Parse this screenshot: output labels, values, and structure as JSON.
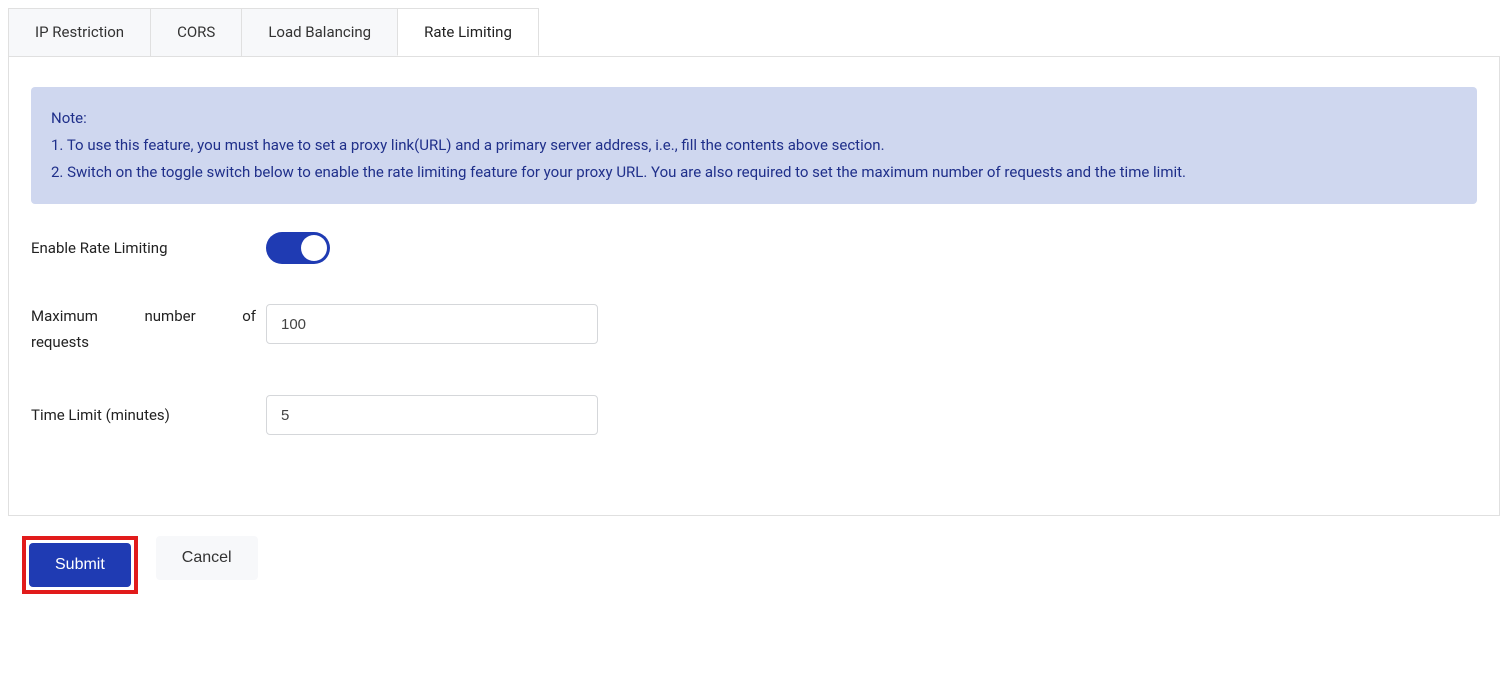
{
  "tabs": [
    {
      "label": "IP Restriction"
    },
    {
      "label": "CORS"
    },
    {
      "label": "Load Balancing"
    },
    {
      "label": "Rate Limiting"
    }
  ],
  "note": {
    "heading": "Note:",
    "line1": "1. To use this feature, you must have to set a proxy link(URL) and a primary server address, i.e., fill the contents above section.",
    "line2": "2. Switch on the toggle switch below to enable the rate limiting feature for your proxy URL. You are also required to set the maximum number of requests and the time limit."
  },
  "form": {
    "enable_label": "Enable Rate Limiting",
    "enable_value": true,
    "max_requests_label_line1": "Maximum number of",
    "max_requests_label_line2": "requests",
    "max_requests_value": "100",
    "time_limit_label": "Time Limit (minutes)",
    "time_limit_value": "5"
  },
  "buttons": {
    "submit": "Submit",
    "cancel": "Cancel"
  }
}
